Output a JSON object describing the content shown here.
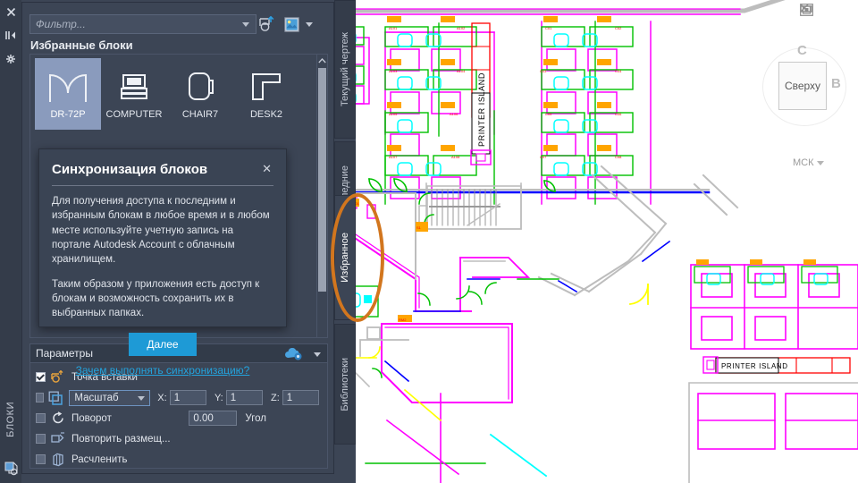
{
  "palette": {
    "vertical_title": "БЛОКИ",
    "icons": [
      {
        "name": "close-icon",
        "glyph": "✕"
      },
      {
        "name": "auto-hide-icon",
        "glyph": "▸◂"
      },
      {
        "name": "properties-icon",
        "glyph": "✳"
      }
    ],
    "filter": {
      "placeholder": "Фильтр...",
      "add_block_icon": "add-block-definition-icon",
      "view_options_icon": "view-options-icon"
    },
    "section_title": "Избранные блоки",
    "blocks": [
      {
        "label": "DR-72P",
        "icon": "door-block-icon",
        "selected": true
      },
      {
        "label": "COMPUTER",
        "icon": "computer-block-icon",
        "selected": false
      },
      {
        "label": "CHAIR7",
        "icon": "chair-block-icon",
        "selected": false
      },
      {
        "label": "DESK2",
        "icon": "desk-block-icon",
        "selected": false
      }
    ],
    "tabs": [
      {
        "label": "Текущий чертеж",
        "active": false,
        "highlighted": false
      },
      {
        "label": "Последние",
        "active": false,
        "highlighted": false
      },
      {
        "label": "Избранное",
        "active": true,
        "highlighted": true
      },
      {
        "label": "Библиотеки",
        "active": false,
        "highlighted": false
      }
    ]
  },
  "dialog": {
    "title": "Синхронизация блоков",
    "close_label": "✕",
    "paragraph1": "Для получения доступа к последним и избранным блокам в любое время и в любом месте используйте учетную запись на портале Autodesk Account с облачным хранилищем.",
    "paragraph2": "Таким образом у приложения есть доступ к блокам и возможность сохранить их в выбранных папках.",
    "button_label": "Далее",
    "link_label": "Зачем выполнять синхронизацию?"
  },
  "parameters": {
    "title": "Параметры",
    "rows": {
      "insertion_point": {
        "label": "Точка вставки",
        "checked": true,
        "icon": "insertion-point-icon"
      },
      "scale": {
        "label": "Масштаб",
        "checked": false,
        "icon": "scale-icon",
        "x_label": "X:",
        "x_value": "1",
        "y_label": "Y:",
        "y_value": "1",
        "z_label": "Z:",
        "z_value": "1"
      },
      "rotation": {
        "label": "Поворот",
        "checked": false,
        "icon": "rotate-icon",
        "value": "0.00",
        "unit_label": "Угол"
      },
      "repeat": {
        "label": "Повторить размещ...",
        "checked": false,
        "icon": "repeat-placement-icon"
      },
      "explode": {
        "label": "Расчленить",
        "checked": false,
        "icon": "explode-icon"
      }
    }
  },
  "canvas": {
    "viewcube": {
      "face_label": "Сверху",
      "north_label": "С",
      "east_label": "В"
    },
    "ucs_label": "МСК",
    "annotations": [
      {
        "label": "PRINTER ISLAND",
        "position": "upper-middle"
      },
      {
        "label": "PRINTER ISLAND",
        "position": "lower-right"
      }
    ],
    "window_controls": [
      {
        "name": "minimize-button",
        "glyph": "▭"
      },
      {
        "name": "restore-button",
        "glyph": "❐"
      }
    ]
  },
  "colors": {
    "panel_bg": "#3c4555",
    "panel_dark": "#343c4a",
    "accent_blue": "#1e9ad6",
    "link_blue": "#23a3dd",
    "selection": "#8a9bbd",
    "highlight_orange": "#d2761e"
  }
}
